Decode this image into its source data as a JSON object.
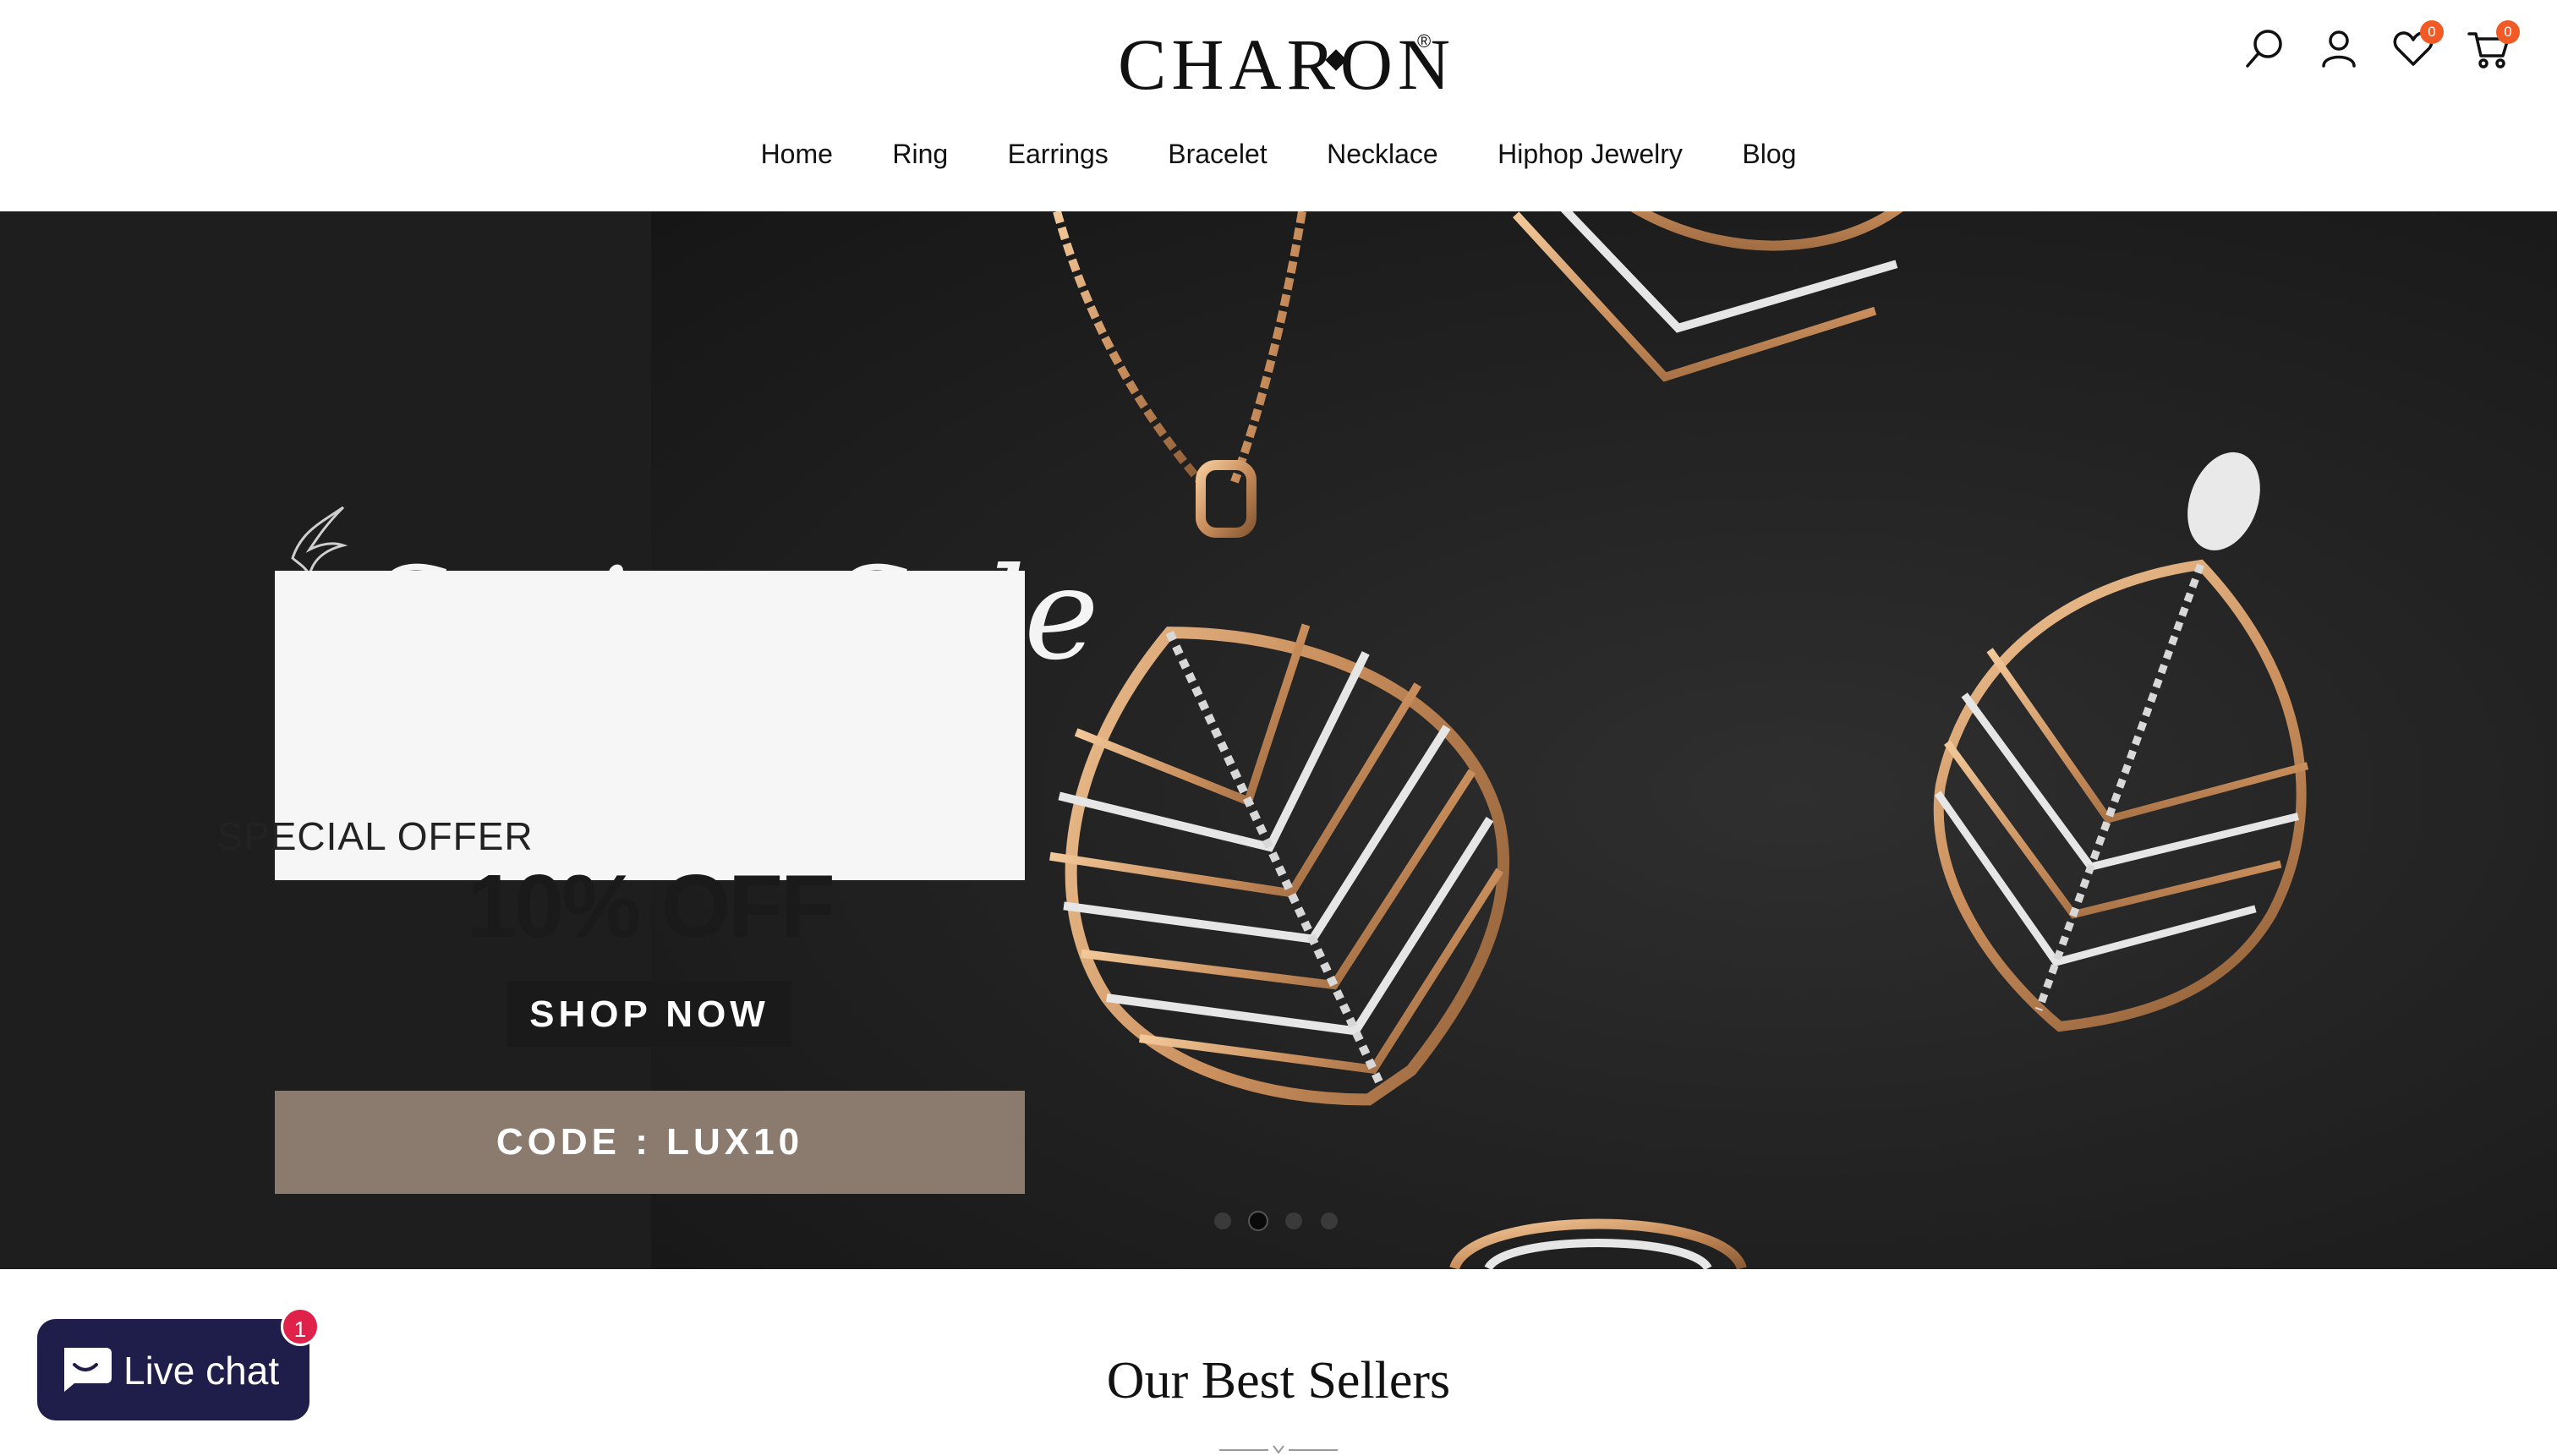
{
  "header": {
    "logo": "CHARON",
    "logo_mark": "®",
    "icons": {
      "search": "search-icon",
      "account": "user-icon",
      "wishlist": "heart-icon",
      "cart": "cart-icon"
    },
    "wishlist_count": "0",
    "cart_count": "0",
    "badge_color": "#f15a24"
  },
  "nav": {
    "items": [
      {
        "label": "Home"
      },
      {
        "label": "Ring"
      },
      {
        "label": "Earrings"
      },
      {
        "label": "Bracelet"
      },
      {
        "label": "Necklace"
      },
      {
        "label": "Hiphop Jewelry"
      },
      {
        "label": "Blog"
      }
    ]
  },
  "hero": {
    "script_title": "Spring Sale",
    "offer_title": "SPECIAL OFFER",
    "offer_discount": "10% OFF",
    "cta_label": "SHOP NOW",
    "code_text": "CODE : LUX10",
    "code_band_color": "#8b7b6e",
    "slides_total": 4,
    "active_slide": 2
  },
  "sections": {
    "best_sellers_title": "Our Best Sellers"
  },
  "chat": {
    "label": "Live chat",
    "unread": "1",
    "color": "#1f1d4a"
  }
}
